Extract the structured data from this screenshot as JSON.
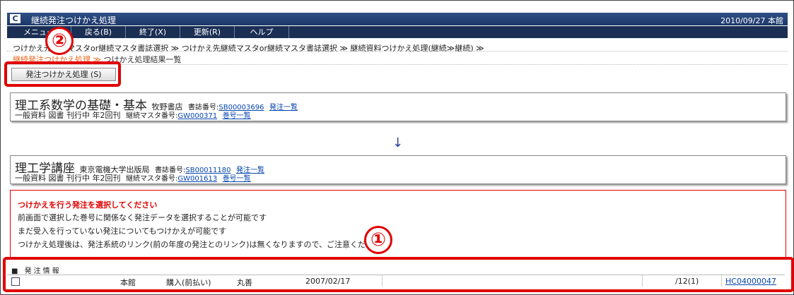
{
  "window": {
    "logo": "C",
    "title": "継続発注つけかえ処理",
    "right": "2010/09/27 本館"
  },
  "menu": {
    "items": [
      "メニュー",
      "戻る(B)",
      "終了(X)",
      "更新(R)",
      "ヘルプ"
    ]
  },
  "breadcrumb": {
    "line1": "つけかえ元継続マスタor継続マスタ書誌選択 ≫ つけかえ先継続マスタor継続マスタ書誌選択 ≫ 継続資料つけかえ処理(継続≫継続) ≫",
    "line2_red": "継続発注つけかえ処理 ≫",
    "line2": "つけかえ処理結果一覧"
  },
  "action": {
    "button_label": "発注つけかえ処理 (S)"
  },
  "annotations": {
    "one": "①",
    "two": "②"
  },
  "source": {
    "title": "理工系数学の基礎・基本",
    "publisher": "牧野書店",
    "biblio_label": "書誌番号:",
    "biblio_no": "SB00003696",
    "order_link": "発注一覧",
    "meta": "一般資料 図書 刊行中 年2回刊",
    "master_label": "継続マスタ番号:",
    "master_no": "GW000371",
    "vol_link": "巻号一覧"
  },
  "arrow": "↓",
  "target": {
    "title": "理工学講座",
    "publisher": "東京電機大学出版局",
    "biblio_label": "書誌番号:",
    "biblio_no": "SB00011180",
    "order_link": "発注一覧",
    "meta": "一般資料 図書 刊行中 年2回刊",
    "master_label": "継続マスタ番号:",
    "master_no": "GW001613",
    "vol_link": "巻号一覧"
  },
  "notice": {
    "heading": "つけかえを行う発注を選択してください",
    "lines": [
      "前画面で選択した巻号に関係なく発注データを選択することが可能です",
      "まだ受入を行っていない発注についてもつけかえが可能です",
      "つけかえ処理後は、発注系統のリンク(前の年度の発注とのリンク)は無くなりますので、ご注意ください"
    ]
  },
  "orders": {
    "header": "■ 発注情報",
    "rows": [
      {
        "library": "本館",
        "type": "購入(前払い)",
        "vendor": "丸善",
        "date": "2007/02/17",
        "volume": "/12(1)",
        "order_no": "HC04000047"
      }
    ]
  },
  "colors": {
    "title_bg": "#1d3868",
    "menu_bg": "#1b2f55",
    "highlight": "#e00000",
    "link": "#0645ad"
  }
}
